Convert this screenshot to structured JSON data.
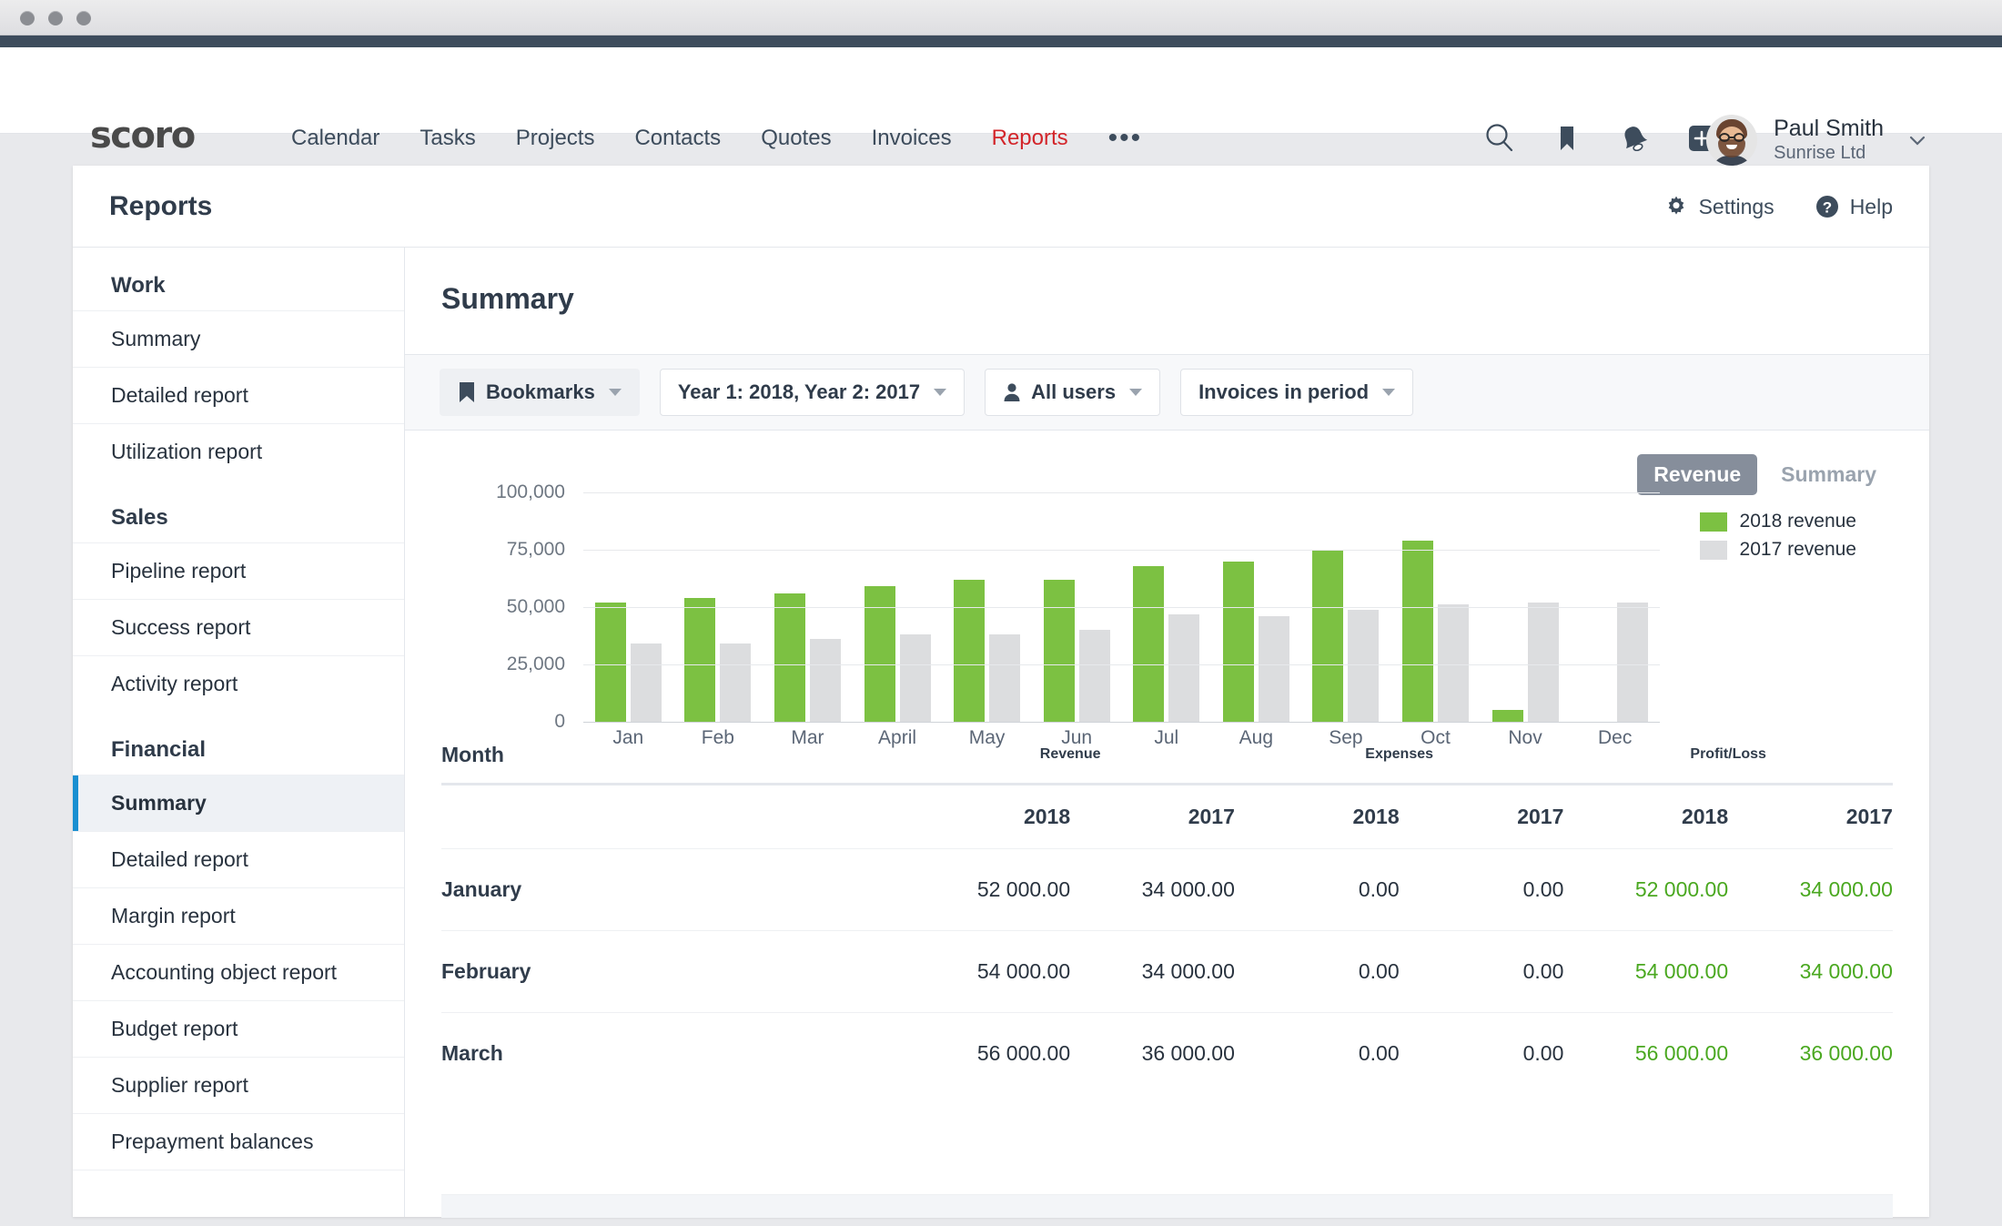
{
  "window": {
    "dots": 3
  },
  "topnav": {
    "logo_text": "scoro",
    "links": [
      {
        "label": "Calendar",
        "active": false
      },
      {
        "label": "Tasks",
        "active": false
      },
      {
        "label": "Projects",
        "active": false
      },
      {
        "label": "Contacts",
        "active": false
      },
      {
        "label": "Quotes",
        "active": false
      },
      {
        "label": "Invoices",
        "active": false
      },
      {
        "label": "Reports",
        "active": true
      }
    ],
    "more_label": "•••",
    "icons": [
      "search-icon",
      "bookmark-icon",
      "bell-icon",
      "plus-icon"
    ],
    "user": {
      "name": "Paul Smith",
      "org": "Sunrise Ltd"
    },
    "brand_red": "#d3252a"
  },
  "card": {
    "title": "Reports",
    "actions": [
      {
        "label": "Settings",
        "icon": "gear-icon"
      },
      {
        "label": "Help",
        "icon": "question-circle-icon"
      }
    ]
  },
  "sidebar": {
    "groups": [
      {
        "title": "Work",
        "items": [
          {
            "label": "Summary",
            "active": false
          },
          {
            "label": "Detailed report",
            "active": false
          },
          {
            "label": "Utilization report",
            "active": false
          }
        ]
      },
      {
        "title": "Sales",
        "items": [
          {
            "label": "Pipeline report",
            "active": false
          },
          {
            "label": "Success report",
            "active": false
          },
          {
            "label": "Activity report",
            "active": false
          }
        ]
      },
      {
        "title": "Financial",
        "items": [
          {
            "label": "Summary",
            "active": true
          },
          {
            "label": "Detailed report",
            "active": false
          },
          {
            "label": "Margin report",
            "active": false
          },
          {
            "label": "Accounting object report",
            "active": false
          },
          {
            "label": "Budget report",
            "active": false
          },
          {
            "label": "Supplier report",
            "active": false
          },
          {
            "label": "Prepayment balances",
            "active": false
          }
        ]
      }
    ],
    "active_accent": "#1a8fd1"
  },
  "main": {
    "title": "Summary",
    "filters": [
      {
        "label": "Bookmarks",
        "icon": "bookmark-icon",
        "shaded": true,
        "caret": true
      },
      {
        "label": "Year 1: 2018, Year 2: 2017",
        "icon": null,
        "shaded": false,
        "caret": true
      },
      {
        "label": "All users",
        "icon": "person-icon",
        "shaded": false,
        "caret": true
      },
      {
        "label": "Invoices in period",
        "icon": null,
        "shaded": false,
        "caret": true
      }
    ],
    "chart_tabs": [
      {
        "label": "Revenue",
        "active": true
      },
      {
        "label": "Summary",
        "active": false
      }
    ]
  },
  "chart_data": {
    "type": "bar",
    "title": "",
    "xlabel": "",
    "ylabel": "",
    "grid": true,
    "legend_position": "right",
    "ylim": [
      0,
      100000
    ],
    "yticks": [
      0,
      25000,
      50000,
      75000,
      100000
    ],
    "ytick_labels": [
      "0",
      "25,000",
      "50,000",
      "75,000",
      "100,000"
    ],
    "categories": [
      "Jan",
      "Feb",
      "Mar",
      "April",
      "May",
      "Jun",
      "Jul",
      "Aug",
      "Sep",
      "Oct",
      "Nov",
      "Dec"
    ],
    "series": [
      {
        "name": "2018 revenue",
        "color": "#7cc142",
        "values": [
          52000,
          54000,
          56000,
          59000,
          62000,
          62000,
          68000,
          70000,
          75000,
          79000,
          5000,
          0
        ]
      },
      {
        "name": "2017 revenue",
        "color": "#dcdddf",
        "values": [
          34000,
          34000,
          36000,
          38000,
          38000,
          40000,
          47000,
          46000,
          49000,
          51000,
          52000,
          52000
        ]
      }
    ]
  },
  "table": {
    "group_headers": [
      "Month",
      "Revenue",
      "Expenses",
      "Profit/Loss"
    ],
    "year_headers": [
      "2018",
      "2017",
      "2018",
      "2017",
      "2018",
      "2017"
    ],
    "rows": [
      {
        "month": "January",
        "revenue_2018": "52 000.00",
        "revenue_2017": "34 000.00",
        "expenses_2018": "0.00",
        "expenses_2017": "0.00",
        "profit_2018": "52 000.00",
        "profit_2017": "34 000.00"
      },
      {
        "month": "February",
        "revenue_2018": "54 000.00",
        "revenue_2017": "34 000.00",
        "expenses_2018": "0.00",
        "expenses_2017": "0.00",
        "profit_2018": "54 000.00",
        "profit_2017": "34 000.00"
      },
      {
        "month": "March",
        "revenue_2018": "56 000.00",
        "revenue_2017": "36 000.00",
        "expenses_2018": "0.00",
        "expenses_2017": "0.00",
        "profit_2018": "56 000.00",
        "profit_2017": "36 000.00"
      }
    ],
    "profit_color": "#4aa820"
  }
}
